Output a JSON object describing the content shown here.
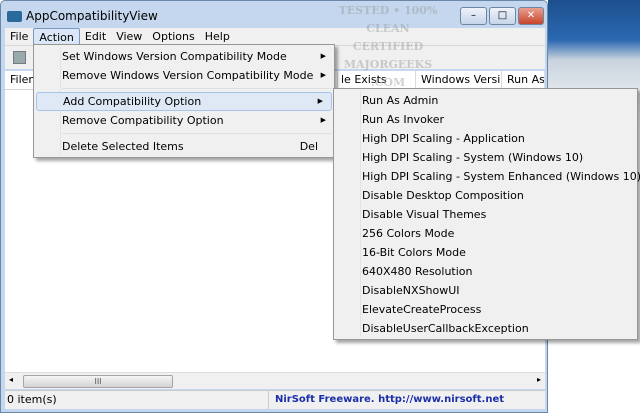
{
  "window": {
    "title": "AppCompatibilityView",
    "minimize": "–",
    "maximize": "□",
    "close": "✕"
  },
  "menubar": [
    "File",
    "Action",
    "Edit",
    "View",
    "Options",
    "Help"
  ],
  "columns": [
    "Filen",
    "le Exists",
    "Windows Versi...",
    "Run As A"
  ],
  "action_menu": {
    "items": [
      {
        "label": "Set Windows Version Compatibility Mode",
        "submenu": true
      },
      {
        "label": "Remove Windows Version Compatibility Mode",
        "submenu": true
      },
      {
        "label": "Add Compatibility Option",
        "submenu": true,
        "highlighted": true
      },
      {
        "label": "Remove Compatibility Option",
        "submenu": true
      },
      {
        "label": "Delete Selected Items",
        "shortcut": "Del"
      }
    ]
  },
  "submenu": [
    "Run As Admin",
    "Run As Invoker",
    "High DPI Scaling - Application",
    "High DPI Scaling - System (Windows 10)",
    "High DPI Scaling - System Enhanced (Windows 10)",
    "Disable Desktop Composition",
    "Disable Visual Themes",
    "256 Colors Mode",
    "16-Bit Colors Mode",
    "640X480 Resolution",
    "DisableNXShowUI",
    "ElevateCreateProcess",
    "DisableUserCallbackException"
  ],
  "status": {
    "count": "0 item(s)",
    "credit": "NirSoft Freeware.  http://www.nirsoft.net",
    "credit_color": "#1b2fa8"
  },
  "scroll_thumb": "III",
  "watermark": [
    "TESTED • 100% CLEAN",
    "CERTIFIED",
    "MAJORGEEKS",
    ".COM"
  ]
}
